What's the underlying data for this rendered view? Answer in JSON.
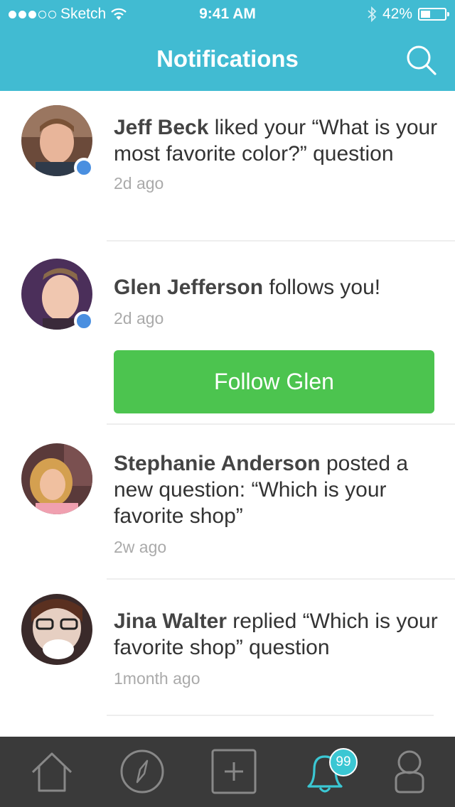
{
  "status_bar": {
    "carrier": "Sketch",
    "time": "9:41 AM",
    "battery_percent": "42%",
    "battery_level": 0.42,
    "signal_bars_filled": 3,
    "signal_bars_total": 5
  },
  "nav": {
    "title": "Notifications",
    "search_icon": "search-icon"
  },
  "notifications": [
    {
      "name": "Jeff Beck",
      "text": " liked your “What is your most favorite color?” question",
      "time": "2d ago",
      "online": true
    },
    {
      "name": "Glen Jefferson",
      "text": " follows you!",
      "time": "2d ago",
      "online": true,
      "action_label": "Follow Glen"
    },
    {
      "name": "Stephanie Anderson",
      "text": " posted a new question: “Which is your favorite shop”",
      "time": "2w ago",
      "online": false
    },
    {
      "name": "Jina Walter",
      "text": " replied “Which is your favorite shop” question",
      "time": "1month ago",
      "online": false
    }
  ],
  "tabbar": {
    "tabs": [
      "home-icon",
      "compass-icon",
      "add-icon",
      "bell-icon",
      "profile-icon"
    ],
    "active": "bell-icon",
    "badge": "99"
  },
  "colors": {
    "header": "#41bbd2",
    "follow_button": "#4cc44f",
    "online_dot": "#4a8fe0",
    "tabbar": "#3a3a3a",
    "active_tab": "#3bc7d3"
  }
}
